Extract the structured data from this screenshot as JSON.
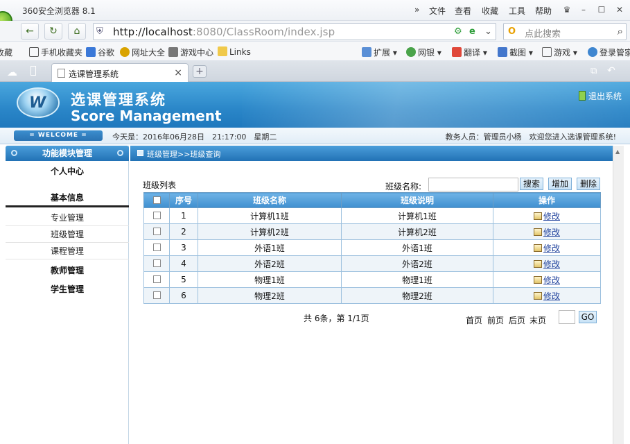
{
  "browser": {
    "app_title": "360安全浏览器 8.1",
    "menu": [
      "»",
      "文件",
      "查看",
      "收藏",
      "工具",
      "帮助"
    ],
    "url_host": "http://localhost",
    "url_rest": ":8080/ClassRoom/index.jsp",
    "search_placeholder": "点此搜索",
    "favorites": [
      "收藏",
      "手机收藏夹",
      "谷歌",
      "网址大全",
      "游戏中心",
      "Links"
    ],
    "tools": [
      "扩展",
      "网银",
      "翻译",
      "截图",
      "游戏",
      "登录管家"
    ],
    "tab_title": "选课管理系统",
    "tab_close": "×",
    "tab_new": "+"
  },
  "header": {
    "logo_letter": "W",
    "title": "选课管理系统",
    "subtitle": "Score Management",
    "logout": "退出系统",
    "welcome": "WELCOME",
    "today": "今天是：2016年06月28日　21:17:00　星期二",
    "user_info": "教务人员：管理员小杨　欢迎您进入选课管理系统!"
  },
  "sidebar": {
    "title": "功能模块管理",
    "group_personal": "个人中心",
    "group_basic": "基本信息",
    "items": [
      "专业管理",
      "班级管理",
      "课程管理"
    ],
    "group_teacher": "教师管理",
    "group_student": "学生管理"
  },
  "main": {
    "breadcrumb": "班级管理>>班级查询",
    "list_label": "班级列表",
    "name_label": "班级名称:",
    "name_value": "",
    "btn_search": "搜索",
    "btn_add": "增加",
    "btn_delete": "删除",
    "columns": [
      "序号",
      "班级名称",
      "班级说明",
      "操作"
    ],
    "rows": [
      {
        "no": "1",
        "name": "计算机1班",
        "desc": "计算机1班",
        "action": "修改"
      },
      {
        "no": "2",
        "name": "计算机2班",
        "desc": "计算机2班",
        "action": "修改"
      },
      {
        "no": "3",
        "name": "外语1班",
        "desc": "外语1班",
        "action": "修改"
      },
      {
        "no": "4",
        "name": "外语2班",
        "desc": "外语2班",
        "action": "修改"
      },
      {
        "no": "5",
        "name": "物理1班",
        "desc": "物理1班",
        "action": "修改"
      },
      {
        "no": "6",
        "name": "物理2班",
        "desc": "物理2班",
        "action": "修改"
      }
    ],
    "pager_total": "共 6条，第 1/1页",
    "pager_first": "首页",
    "pager_prev": "前页",
    "pager_next": "后页",
    "pager_last": "末页",
    "page_value": "",
    "go": "GO"
  },
  "colors": {
    "header_blue": "#2a86c8",
    "grid_header": "#4f9ad6",
    "link": "#1c3f9b"
  }
}
